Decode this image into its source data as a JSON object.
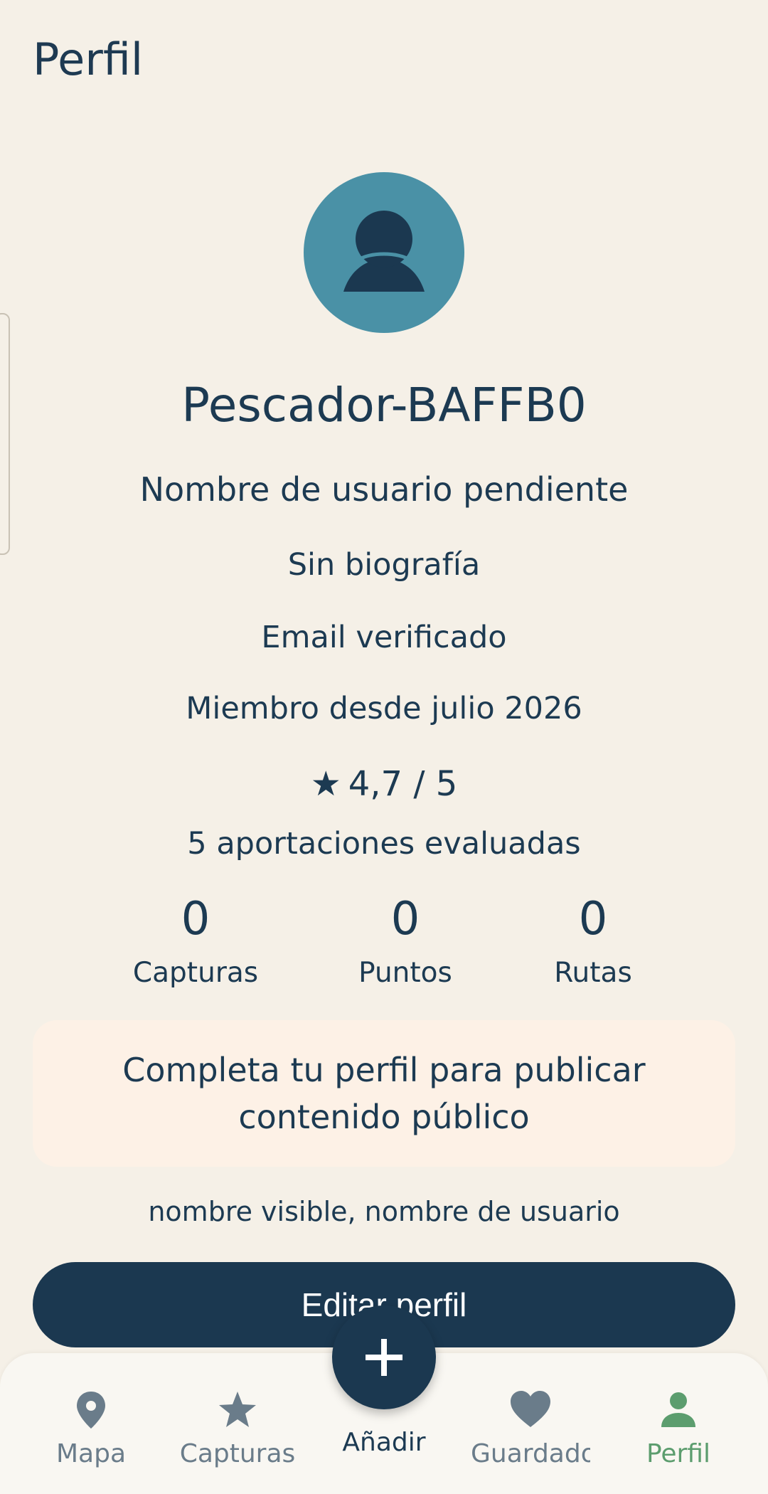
{
  "header": {
    "title": "Perfil"
  },
  "profile": {
    "display_name": "Pescador-BAFFB0",
    "username_status": "Nombre de usuario pendiente",
    "bio": "Sin biografía",
    "email_status": "Email verificado",
    "member_since": "Miembro desde julio 2026",
    "rating_star": "★",
    "rating": "4,7 / 5",
    "rating_value": 4.7,
    "reviews": "5 aportaciones evaluadas"
  },
  "stats": [
    {
      "value": "0",
      "label": "Capturas"
    },
    {
      "value": "0",
      "label": "Puntos"
    },
    {
      "value": "0",
      "label": "Rutas"
    }
  ],
  "notice": {
    "text": "Completa tu perfil para publicar contenido público",
    "missing_fields": "nombre visible, nombre de usuario"
  },
  "actions": {
    "edit_profile": "Editar perfil"
  },
  "nav": {
    "items": [
      {
        "label": "Mapa",
        "icon": "map-pin-icon"
      },
      {
        "label": "Capturas",
        "icon": "star-icon"
      },
      {
        "label": "Añadir",
        "icon": "plus-icon"
      },
      {
        "label": "Guardados",
        "icon": "heart-icon"
      },
      {
        "label": "Perfil",
        "icon": "person-icon",
        "active": true
      }
    ]
  },
  "colors": {
    "background": "#f5f0e7",
    "primary": "#1b3850",
    "avatar": "#4a91a6",
    "active_nav": "#5c9d6e",
    "notice_bg": "#fdf1e6"
  }
}
